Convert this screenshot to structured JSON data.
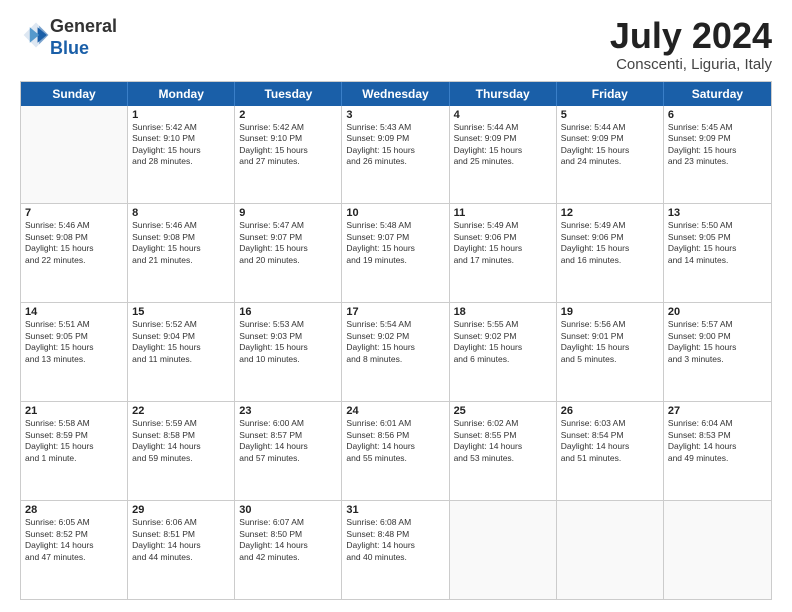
{
  "logo": {
    "general": "General",
    "blue": "Blue"
  },
  "header": {
    "title": "July 2024",
    "subtitle": "Conscenti, Liguria, Italy"
  },
  "weekdays": [
    "Sunday",
    "Monday",
    "Tuesday",
    "Wednesday",
    "Thursday",
    "Friday",
    "Saturday"
  ],
  "rows": [
    [
      {
        "day": "",
        "info": ""
      },
      {
        "day": "1",
        "info": "Sunrise: 5:42 AM\nSunset: 9:10 PM\nDaylight: 15 hours\nand 28 minutes."
      },
      {
        "day": "2",
        "info": "Sunrise: 5:42 AM\nSunset: 9:10 PM\nDaylight: 15 hours\nand 27 minutes."
      },
      {
        "day": "3",
        "info": "Sunrise: 5:43 AM\nSunset: 9:09 PM\nDaylight: 15 hours\nand 26 minutes."
      },
      {
        "day": "4",
        "info": "Sunrise: 5:44 AM\nSunset: 9:09 PM\nDaylight: 15 hours\nand 25 minutes."
      },
      {
        "day": "5",
        "info": "Sunrise: 5:44 AM\nSunset: 9:09 PM\nDaylight: 15 hours\nand 24 minutes."
      },
      {
        "day": "6",
        "info": "Sunrise: 5:45 AM\nSunset: 9:09 PM\nDaylight: 15 hours\nand 23 minutes."
      }
    ],
    [
      {
        "day": "7",
        "info": "Sunrise: 5:46 AM\nSunset: 9:08 PM\nDaylight: 15 hours\nand 22 minutes."
      },
      {
        "day": "8",
        "info": "Sunrise: 5:46 AM\nSunset: 9:08 PM\nDaylight: 15 hours\nand 21 minutes."
      },
      {
        "day": "9",
        "info": "Sunrise: 5:47 AM\nSunset: 9:07 PM\nDaylight: 15 hours\nand 20 minutes."
      },
      {
        "day": "10",
        "info": "Sunrise: 5:48 AM\nSunset: 9:07 PM\nDaylight: 15 hours\nand 19 minutes."
      },
      {
        "day": "11",
        "info": "Sunrise: 5:49 AM\nSunset: 9:06 PM\nDaylight: 15 hours\nand 17 minutes."
      },
      {
        "day": "12",
        "info": "Sunrise: 5:49 AM\nSunset: 9:06 PM\nDaylight: 15 hours\nand 16 minutes."
      },
      {
        "day": "13",
        "info": "Sunrise: 5:50 AM\nSunset: 9:05 PM\nDaylight: 15 hours\nand 14 minutes."
      }
    ],
    [
      {
        "day": "14",
        "info": "Sunrise: 5:51 AM\nSunset: 9:05 PM\nDaylight: 15 hours\nand 13 minutes."
      },
      {
        "day": "15",
        "info": "Sunrise: 5:52 AM\nSunset: 9:04 PM\nDaylight: 15 hours\nand 11 minutes."
      },
      {
        "day": "16",
        "info": "Sunrise: 5:53 AM\nSunset: 9:03 PM\nDaylight: 15 hours\nand 10 minutes."
      },
      {
        "day": "17",
        "info": "Sunrise: 5:54 AM\nSunset: 9:02 PM\nDaylight: 15 hours\nand 8 minutes."
      },
      {
        "day": "18",
        "info": "Sunrise: 5:55 AM\nSunset: 9:02 PM\nDaylight: 15 hours\nand 6 minutes."
      },
      {
        "day": "19",
        "info": "Sunrise: 5:56 AM\nSunset: 9:01 PM\nDaylight: 15 hours\nand 5 minutes."
      },
      {
        "day": "20",
        "info": "Sunrise: 5:57 AM\nSunset: 9:00 PM\nDaylight: 15 hours\nand 3 minutes."
      }
    ],
    [
      {
        "day": "21",
        "info": "Sunrise: 5:58 AM\nSunset: 8:59 PM\nDaylight: 15 hours\nand 1 minute."
      },
      {
        "day": "22",
        "info": "Sunrise: 5:59 AM\nSunset: 8:58 PM\nDaylight: 14 hours\nand 59 minutes."
      },
      {
        "day": "23",
        "info": "Sunrise: 6:00 AM\nSunset: 8:57 PM\nDaylight: 14 hours\nand 57 minutes."
      },
      {
        "day": "24",
        "info": "Sunrise: 6:01 AM\nSunset: 8:56 PM\nDaylight: 14 hours\nand 55 minutes."
      },
      {
        "day": "25",
        "info": "Sunrise: 6:02 AM\nSunset: 8:55 PM\nDaylight: 14 hours\nand 53 minutes."
      },
      {
        "day": "26",
        "info": "Sunrise: 6:03 AM\nSunset: 8:54 PM\nDaylight: 14 hours\nand 51 minutes."
      },
      {
        "day": "27",
        "info": "Sunrise: 6:04 AM\nSunset: 8:53 PM\nDaylight: 14 hours\nand 49 minutes."
      }
    ],
    [
      {
        "day": "28",
        "info": "Sunrise: 6:05 AM\nSunset: 8:52 PM\nDaylight: 14 hours\nand 47 minutes."
      },
      {
        "day": "29",
        "info": "Sunrise: 6:06 AM\nSunset: 8:51 PM\nDaylight: 14 hours\nand 44 minutes."
      },
      {
        "day": "30",
        "info": "Sunrise: 6:07 AM\nSunset: 8:50 PM\nDaylight: 14 hours\nand 42 minutes."
      },
      {
        "day": "31",
        "info": "Sunrise: 6:08 AM\nSunset: 8:48 PM\nDaylight: 14 hours\nand 40 minutes."
      },
      {
        "day": "",
        "info": ""
      },
      {
        "day": "",
        "info": ""
      },
      {
        "day": "",
        "info": ""
      }
    ]
  ]
}
